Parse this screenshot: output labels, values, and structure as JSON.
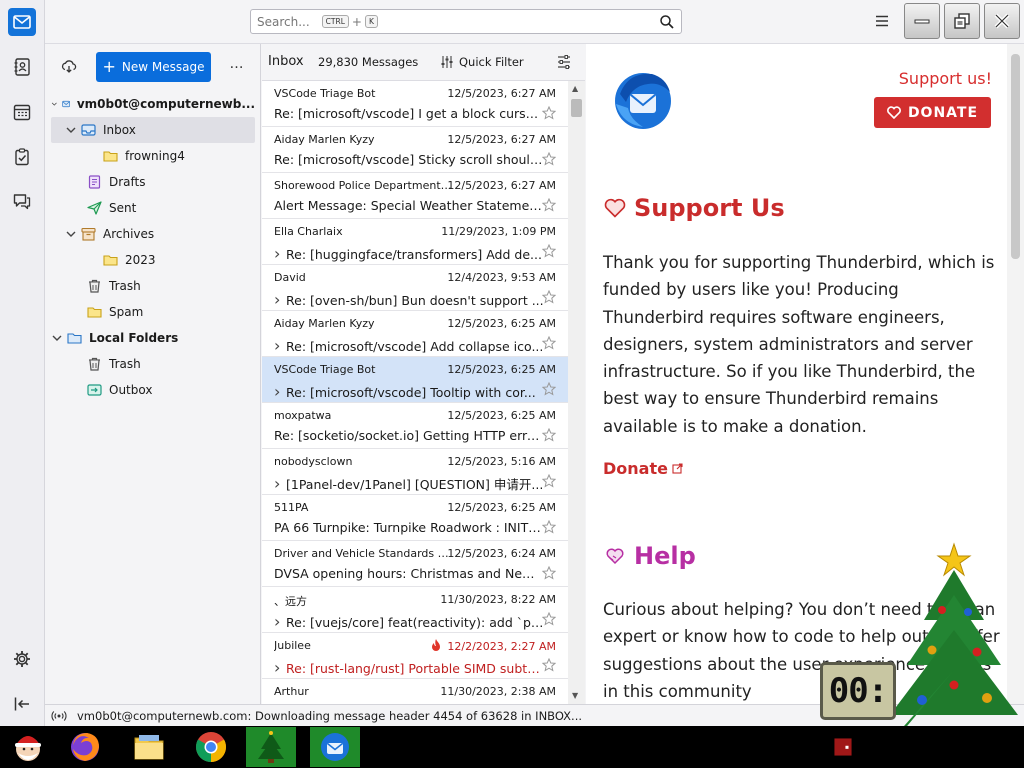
{
  "window": {
    "title": "Thunderbird"
  },
  "search": {
    "placeholder": "Search...",
    "key1": "CTRL",
    "plus": "+",
    "key2": "K"
  },
  "toolbar": {
    "new_message": "New Message",
    "more": "…"
  },
  "folders": {
    "account": "vm0b0t@computernewb...",
    "inbox": "Inbox",
    "frowning4": "frowning4",
    "drafts": "Drafts",
    "sent": "Sent",
    "archives": "Archives",
    "year_2023": "2023",
    "trash": "Trash",
    "spam": "Spam",
    "local_folders": "Local Folders",
    "local_trash": "Trash",
    "outbox": "Outbox"
  },
  "list_header": {
    "folder": "Inbox",
    "count": "29,830 Messages",
    "quick_filter": "Quick Filter"
  },
  "messages": [
    {
      "from": "VSCode Triage Bot",
      "date": "12/5/2023, 6:27 AM",
      "subject": "Re: [microsoft/vscode] I get a block cursor...",
      "thread": false
    },
    {
      "from": "Aiday Marlen Kyzy",
      "date": "12/5/2023, 6:27 AM",
      "subject": "Re: [microsoft/vscode] Sticky scroll should ...",
      "thread": false
    },
    {
      "from": "Shorewood Police Department I...",
      "date": "12/5/2023, 6:27 AM",
      "subject": "Alert Message: Special Weather Statement...",
      "thread": false
    },
    {
      "from": "Ella Charlaix",
      "date": "11/29/2023, 1:09 PM",
      "subject": "Re: [huggingface/transformers] Add de...",
      "thread": true
    },
    {
      "from": "David",
      "date": "12/4/2023, 9:53 AM",
      "subject": "Re: [oven-sh/bun] Bun doesn't support ...",
      "thread": true
    },
    {
      "from": "Aiday Marlen Kyzy",
      "date": "12/5/2023, 6:25 AM",
      "subject": "Re: [microsoft/vscode] Add collapse ico...",
      "thread": true
    },
    {
      "from": "VSCode Triage Bot",
      "date": "12/5/2023, 6:25 AM",
      "subject": "Re: [microsoft/vscode] Tooltip with cor...",
      "thread": true
    },
    {
      "from": "moxpatwa",
      "date": "12/5/2023, 6:25 AM",
      "subject": "Re: [socketio/socket.io] Getting HTTP error...",
      "thread": false
    },
    {
      "from": "nobodysclown",
      "date": "12/5/2023, 5:16 AM",
      "subject": "[1Panel-dev/1Panel] [QUESTION] 申请开...",
      "thread": true
    },
    {
      "from": "511PA",
      "date": "12/5/2023, 6:25 AM",
      "subject": "PA 66 Turnpike: Turnpike Roadwork : INITIAL",
      "thread": false
    },
    {
      "from": "Driver and Vehicle Standards Ag...",
      "date": "12/5/2023, 6:24 AM",
      "subject": "DVSA opening hours: Christmas and New ...",
      "thread": false
    },
    {
      "from": "、远方",
      "date": "11/30/2023, 8:22 AM",
      "subject": "Re: [vuejs/core] feat(reactivity): add `pau...",
      "thread": true
    },
    {
      "from": "Jubilee",
      "date": "12/2/2023, 2:27 AM",
      "subject": "Re: [rust-lang/rust] Portable SIMD subtree...",
      "thread": true
    },
    {
      "from": "Arthur",
      "date": "11/30/2023, 2:38 AM",
      "subject": "",
      "thread": false
    }
  ],
  "reader": {
    "support_link": "Support us!",
    "donate_button": "DONATE",
    "h1": "Support Us",
    "p1": "Thank you for supporting Thunderbird, which is funded by users like you! Producing Thunderbird requires software engineers, designers, system administrators and server infrastructure. So if you like Thunderbird, the best way to ensure Thunderbird remains available is to make a donation.",
    "donate_link": "Donate",
    "h2": "Help",
    "p2": "Curious about helping? You don’t need to be an expert or know how to code to help out, or offer suggestions about the user experience! Join us in this community"
  },
  "status": {
    "text": "vm0b0t@computernewb.com: Downloading message header 4454 of 63628 in INBOX..."
  },
  "desktop": {
    "clock": "00:"
  },
  "colors": {
    "accent": "#0a6ddc",
    "donate_red": "#d22f2f",
    "help_purple": "#b72fa3",
    "selection": "#d3e3f8"
  }
}
